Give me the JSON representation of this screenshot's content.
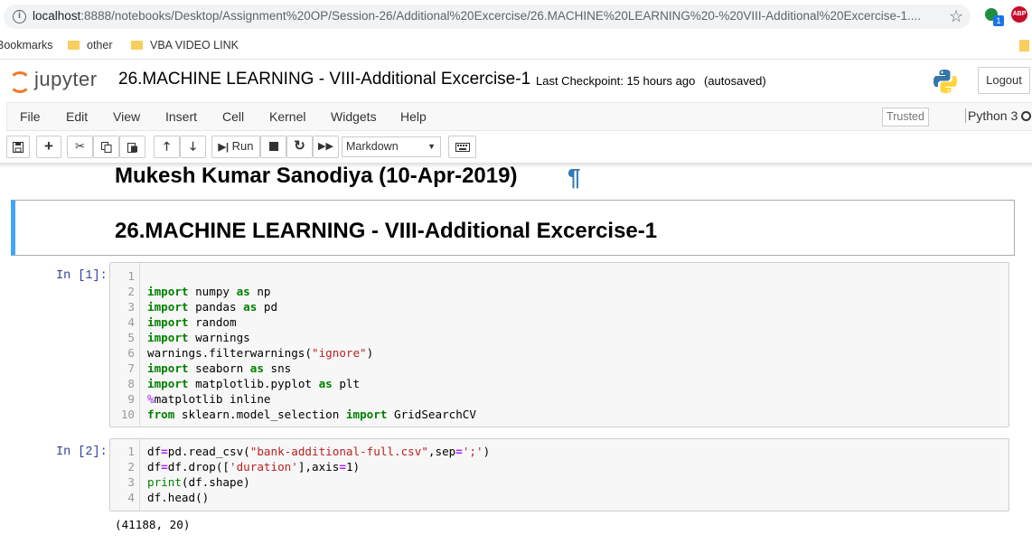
{
  "browser": {
    "url_host": "localhost",
    "url_path": ":8888/notebooks/Desktop/Assignment%20OP/Session-26/Additional%20Excercise/26.MACHINE%20LEARNING%20-%20VIII-Additional%20Excercise-1....",
    "extension_badge": "1",
    "adblock_label": "ABP",
    "bookmarks": [
      "Bookmarks",
      "other",
      "VBA VIDEO LINK"
    ]
  },
  "header": {
    "logo_text": "jupyter",
    "notebook_title": "26.MACHINE LEARNING - VIII-Additional Excercise-1",
    "checkpoint": "Last Checkpoint: 15 hours ago",
    "autosave": "(autosaved)",
    "logout_label": "Logout"
  },
  "menubar": {
    "items": [
      "File",
      "Edit",
      "View",
      "Insert",
      "Cell",
      "Kernel",
      "Widgets",
      "Help"
    ],
    "trusted_label": "Trusted",
    "kernel_name": "Python 3"
  },
  "toolbar": {
    "run_label": "Run",
    "cell_type": "Markdown"
  },
  "cells": {
    "author_heading": "Mukesh Kumar Sanodiya (10-Apr-2019)",
    "pilcrow": "¶",
    "title_heading": "26.MACHINE LEARNING - VIII-Additional Excercise-1",
    "cell1_prompt": "In [1]:",
    "cell2_prompt": "In [2]:",
    "cell2_output": "(41188, 20)"
  },
  "code_cell_1": [
    {
      "n": "1",
      "code": ""
    },
    {
      "n": "2",
      "code": "import numpy as np"
    },
    {
      "n": "3",
      "code": "import pandas as pd"
    },
    {
      "n": "4",
      "code": "import random"
    },
    {
      "n": "5",
      "code": "import warnings"
    },
    {
      "n": "6",
      "code": "warnings.filterwarnings(\"ignore\")"
    },
    {
      "n": "7",
      "code": "import seaborn as sns"
    },
    {
      "n": "8",
      "code": "import matplotlib.pyplot as plt"
    },
    {
      "n": "9",
      "code": "%matplotlib inline"
    },
    {
      "n": "10",
      "code": "from sklearn.model_selection import GridSearchCV"
    }
  ],
  "code_cell_2": [
    {
      "n": "1",
      "code": "df=pd.read_csv(\"bank-additional-full.csv\",sep=';')"
    },
    {
      "n": "2",
      "code": "df=df.drop(['duration'],axis=1)"
    },
    {
      "n": "3",
      "code": "print(df.shape)"
    },
    {
      "n": "4",
      "code": "df.head()"
    }
  ]
}
